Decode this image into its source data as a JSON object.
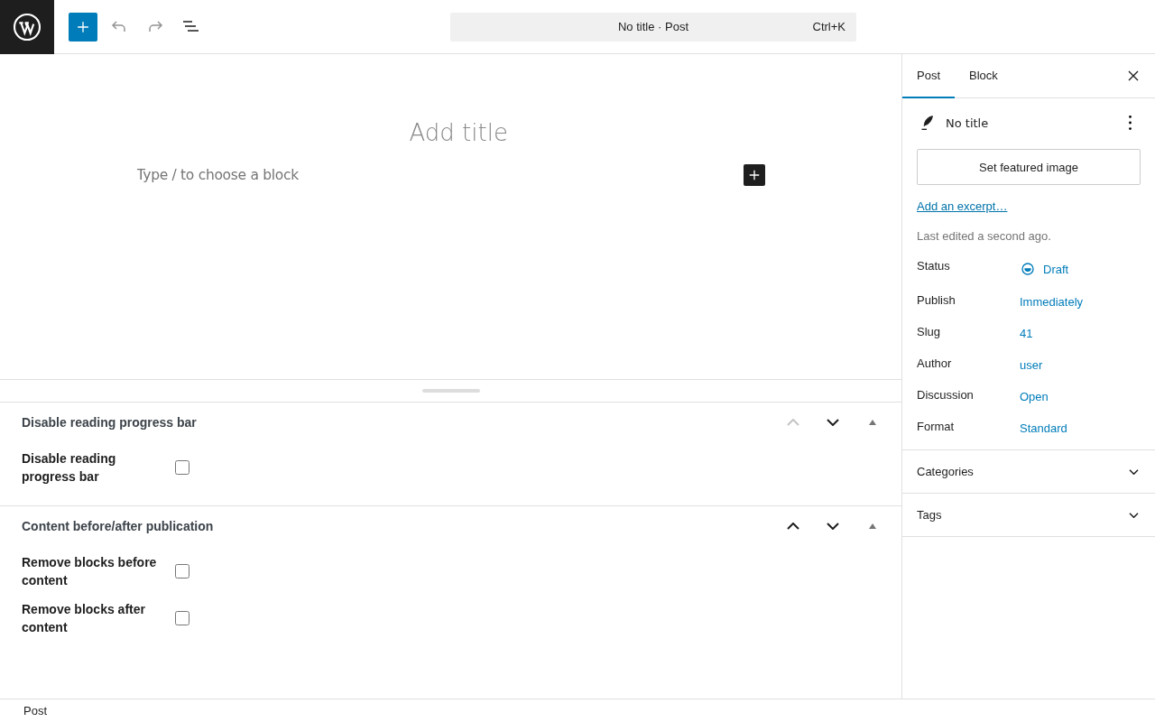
{
  "header": {
    "document_title": "No title · Post",
    "shortcut": "Ctrl+K"
  },
  "editor": {
    "title_placeholder": "Add title",
    "block_placeholder": "Type / to choose a block"
  },
  "meta_boxes": [
    {
      "title": "Disable reading progress bar",
      "move_up_disabled": true,
      "move_down_disabled": false,
      "expanded": true,
      "fields": [
        {
          "label": "Disable reading progress bar",
          "checked": false
        }
      ]
    },
    {
      "title": "Content before/after publication",
      "move_up_disabled": false,
      "move_down_disabled": false,
      "expanded": true,
      "fields": [
        {
          "label": "Remove blocks before content",
          "checked": false
        },
        {
          "label": "Remove blocks after content",
          "checked": false
        }
      ]
    }
  ],
  "sidebar": {
    "tabs": [
      {
        "label": "Post",
        "selected": true
      },
      {
        "label": "Block",
        "selected": false
      }
    ],
    "post_title": "No title",
    "featured_image_button": "Set featured image",
    "excerpt_link": "Add an excerpt…",
    "last_edited": "Last edited a second ago.",
    "fields": [
      {
        "label": "Status",
        "value": "Draft",
        "kind": "status"
      },
      {
        "label": "Publish",
        "value": "Immediately",
        "kind": "link"
      },
      {
        "label": "Slug",
        "value": "41",
        "kind": "link"
      },
      {
        "label": "Author",
        "value": "user",
        "kind": "link"
      },
      {
        "label": "Discussion",
        "value": "Open",
        "kind": "link"
      },
      {
        "label": "Format",
        "value": "Standard",
        "kind": "link"
      }
    ],
    "panels": [
      {
        "title": "Categories",
        "expanded": false
      },
      {
        "title": "Tags",
        "expanded": false
      }
    ]
  },
  "footer": {
    "breadcrumb": "Post"
  }
}
